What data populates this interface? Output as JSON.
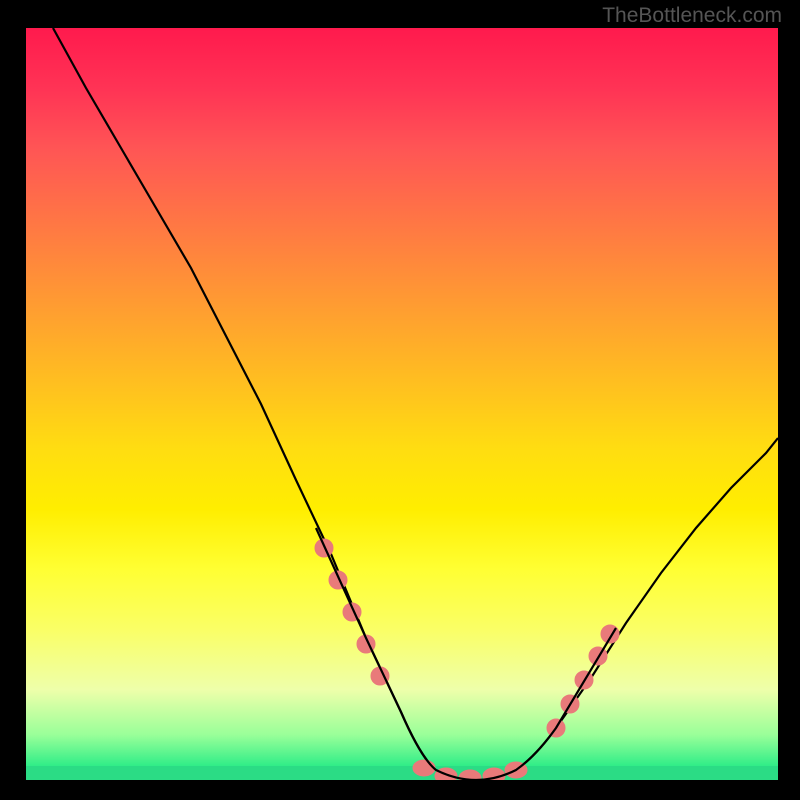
{
  "watermark": "TheBottleneck.com",
  "chart_data": {
    "type": "line",
    "title": "",
    "xlabel": "",
    "ylabel": "",
    "xlim": [
      0,
      100
    ],
    "ylim": [
      0,
      100
    ],
    "series": [
      {
        "name": "bottleneck-curve",
        "x": [
          0,
          5,
          10,
          15,
          20,
          25,
          30,
          35,
          40,
          45,
          50,
          55,
          58,
          62,
          65,
          70,
          75,
          80,
          85,
          90,
          95,
          100
        ],
        "values": [
          100,
          92,
          84,
          76,
          68,
          59,
          50,
          40,
          30,
          19,
          9,
          2,
          0,
          0,
          2,
          9,
          18,
          27,
          35,
          42,
          48,
          53
        ]
      }
    ],
    "markers": {
      "name": "highlighted-points",
      "x": [
        40,
        42,
        44,
        46,
        52,
        56,
        60,
        62,
        64,
        66,
        68,
        70
      ],
      "values": [
        30,
        25,
        20,
        15,
        5,
        1,
        0,
        1,
        4,
        8,
        13,
        19
      ],
      "color": "#e87070"
    },
    "gradient_bands": [
      {
        "color": "#ff1a4d",
        "position": 0
      },
      {
        "color": "#ffbb22",
        "position": 46
      },
      {
        "color": "#ffff33",
        "position": 72
      },
      {
        "color": "#33ee88",
        "position": 98
      }
    ]
  }
}
